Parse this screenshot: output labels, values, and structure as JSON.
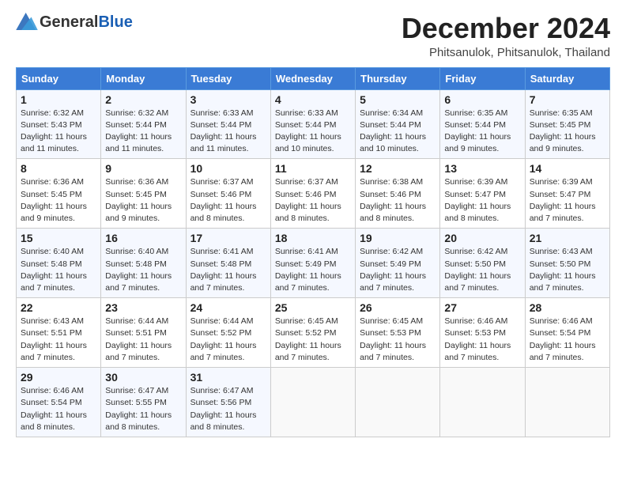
{
  "logo": {
    "general": "General",
    "blue": "Blue"
  },
  "title": "December 2024",
  "subtitle": "Phitsanulok, Phitsanulok, Thailand",
  "days_of_week": [
    "Sunday",
    "Monday",
    "Tuesday",
    "Wednesday",
    "Thursday",
    "Friday",
    "Saturday"
  ],
  "weeks": [
    [
      {
        "day": "1",
        "info": "Sunrise: 6:32 AM\nSunset: 5:43 PM\nDaylight: 11 hours\nand 11 minutes."
      },
      {
        "day": "2",
        "info": "Sunrise: 6:32 AM\nSunset: 5:44 PM\nDaylight: 11 hours\nand 11 minutes."
      },
      {
        "day": "3",
        "info": "Sunrise: 6:33 AM\nSunset: 5:44 PM\nDaylight: 11 hours\nand 11 minutes."
      },
      {
        "day": "4",
        "info": "Sunrise: 6:33 AM\nSunset: 5:44 PM\nDaylight: 11 hours\nand 10 minutes."
      },
      {
        "day": "5",
        "info": "Sunrise: 6:34 AM\nSunset: 5:44 PM\nDaylight: 11 hours\nand 10 minutes."
      },
      {
        "day": "6",
        "info": "Sunrise: 6:35 AM\nSunset: 5:44 PM\nDaylight: 11 hours\nand 9 minutes."
      },
      {
        "day": "7",
        "info": "Sunrise: 6:35 AM\nSunset: 5:45 PM\nDaylight: 11 hours\nand 9 minutes."
      }
    ],
    [
      {
        "day": "8",
        "info": "Sunrise: 6:36 AM\nSunset: 5:45 PM\nDaylight: 11 hours\nand 9 minutes."
      },
      {
        "day": "9",
        "info": "Sunrise: 6:36 AM\nSunset: 5:45 PM\nDaylight: 11 hours\nand 9 minutes."
      },
      {
        "day": "10",
        "info": "Sunrise: 6:37 AM\nSunset: 5:46 PM\nDaylight: 11 hours\nand 8 minutes."
      },
      {
        "day": "11",
        "info": "Sunrise: 6:37 AM\nSunset: 5:46 PM\nDaylight: 11 hours\nand 8 minutes."
      },
      {
        "day": "12",
        "info": "Sunrise: 6:38 AM\nSunset: 5:46 PM\nDaylight: 11 hours\nand 8 minutes."
      },
      {
        "day": "13",
        "info": "Sunrise: 6:39 AM\nSunset: 5:47 PM\nDaylight: 11 hours\nand 8 minutes."
      },
      {
        "day": "14",
        "info": "Sunrise: 6:39 AM\nSunset: 5:47 PM\nDaylight: 11 hours\nand 7 minutes."
      }
    ],
    [
      {
        "day": "15",
        "info": "Sunrise: 6:40 AM\nSunset: 5:48 PM\nDaylight: 11 hours\nand 7 minutes."
      },
      {
        "day": "16",
        "info": "Sunrise: 6:40 AM\nSunset: 5:48 PM\nDaylight: 11 hours\nand 7 minutes."
      },
      {
        "day": "17",
        "info": "Sunrise: 6:41 AM\nSunset: 5:48 PM\nDaylight: 11 hours\nand 7 minutes."
      },
      {
        "day": "18",
        "info": "Sunrise: 6:41 AM\nSunset: 5:49 PM\nDaylight: 11 hours\nand 7 minutes."
      },
      {
        "day": "19",
        "info": "Sunrise: 6:42 AM\nSunset: 5:49 PM\nDaylight: 11 hours\nand 7 minutes."
      },
      {
        "day": "20",
        "info": "Sunrise: 6:42 AM\nSunset: 5:50 PM\nDaylight: 11 hours\nand 7 minutes."
      },
      {
        "day": "21",
        "info": "Sunrise: 6:43 AM\nSunset: 5:50 PM\nDaylight: 11 hours\nand 7 minutes."
      }
    ],
    [
      {
        "day": "22",
        "info": "Sunrise: 6:43 AM\nSunset: 5:51 PM\nDaylight: 11 hours\nand 7 minutes."
      },
      {
        "day": "23",
        "info": "Sunrise: 6:44 AM\nSunset: 5:51 PM\nDaylight: 11 hours\nand 7 minutes."
      },
      {
        "day": "24",
        "info": "Sunrise: 6:44 AM\nSunset: 5:52 PM\nDaylight: 11 hours\nand 7 minutes."
      },
      {
        "day": "25",
        "info": "Sunrise: 6:45 AM\nSunset: 5:52 PM\nDaylight: 11 hours\nand 7 minutes."
      },
      {
        "day": "26",
        "info": "Sunrise: 6:45 AM\nSunset: 5:53 PM\nDaylight: 11 hours\nand 7 minutes."
      },
      {
        "day": "27",
        "info": "Sunrise: 6:46 AM\nSunset: 5:53 PM\nDaylight: 11 hours\nand 7 minutes."
      },
      {
        "day": "28",
        "info": "Sunrise: 6:46 AM\nSunset: 5:54 PM\nDaylight: 11 hours\nand 7 minutes."
      }
    ],
    [
      {
        "day": "29",
        "info": "Sunrise: 6:46 AM\nSunset: 5:54 PM\nDaylight: 11 hours\nand 8 minutes."
      },
      {
        "day": "30",
        "info": "Sunrise: 6:47 AM\nSunset: 5:55 PM\nDaylight: 11 hours\nand 8 minutes."
      },
      {
        "day": "31",
        "info": "Sunrise: 6:47 AM\nSunset: 5:56 PM\nDaylight: 11 hours\nand 8 minutes."
      },
      {
        "day": "",
        "info": ""
      },
      {
        "day": "",
        "info": ""
      },
      {
        "day": "",
        "info": ""
      },
      {
        "day": "",
        "info": ""
      }
    ]
  ]
}
